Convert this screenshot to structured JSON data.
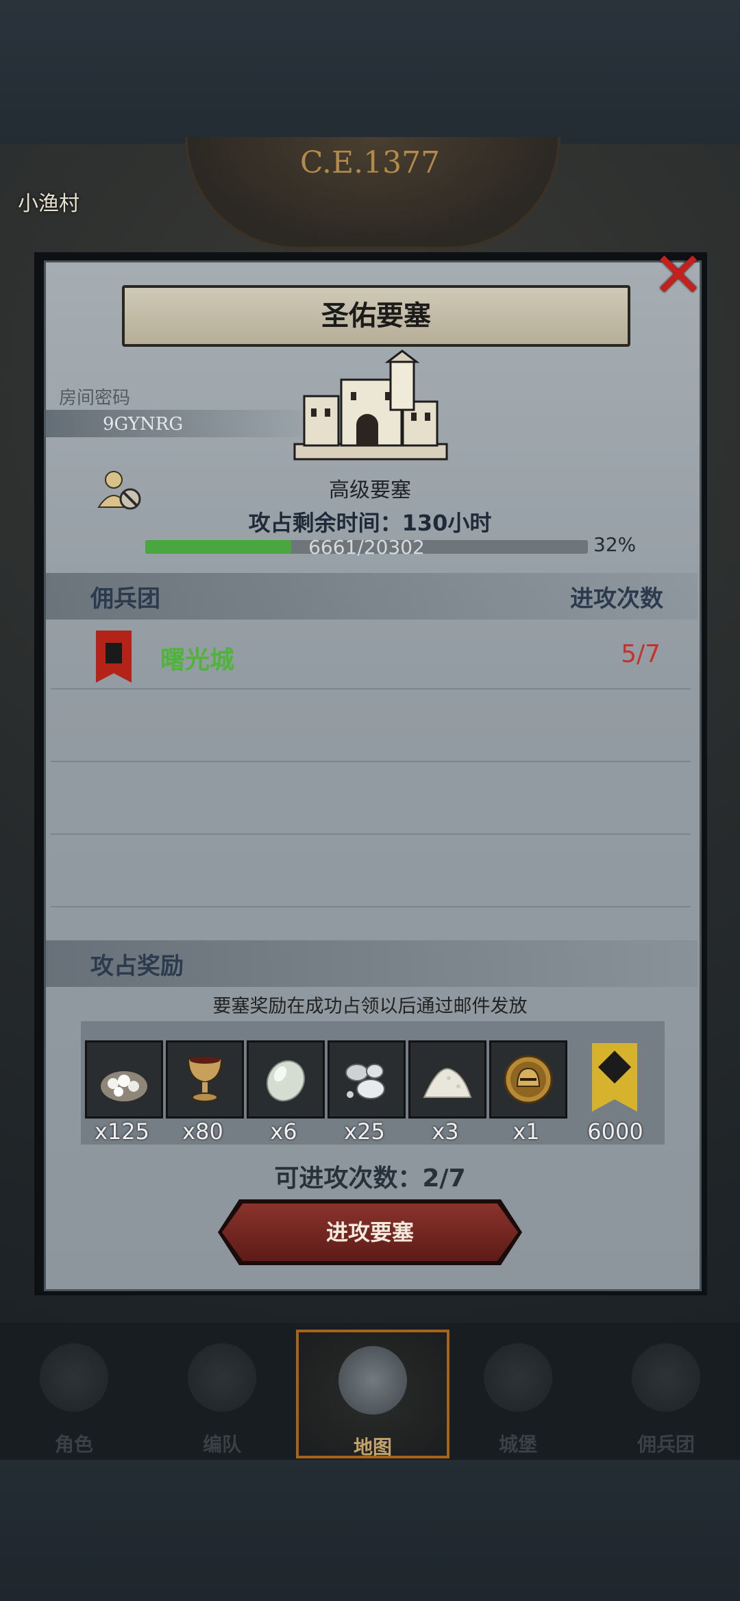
{
  "header": {
    "era": "C.E.1377",
    "village": "小渔村"
  },
  "modal": {
    "title": "圣佑要塞",
    "room_password_label": "房间密码",
    "room_password": "9GYNRG",
    "fortress_type": "高级要塞",
    "time_left": "攻占剩余时间：130小时",
    "progress": {
      "text": "6661/20302",
      "current": 6661,
      "total": 20302,
      "percent": "32%",
      "fraction": 0.33
    },
    "legion_header": "佣兵团",
    "attacks_header": "进攻次数",
    "legions": [
      {
        "name": "曙光城",
        "count": "5/7"
      }
    ],
    "rewards_header": "攻占奖励",
    "rewards_note": "要塞奖励在成功占领以后通过邮件发放",
    "rewards": [
      {
        "icon": "salt-sack-icon",
        "qty": "x125"
      },
      {
        "icon": "goblet-icon",
        "qty": "x80"
      },
      {
        "icon": "gem-stone-icon",
        "qty": "x6"
      },
      {
        "icon": "silver-ore-icon",
        "qty": "x25"
      },
      {
        "icon": "powder-pile-icon",
        "qty": "x3"
      },
      {
        "icon": "knight-helmet-coin-icon",
        "qty": "x1"
      },
      {
        "icon": "gold-banner-medal-icon",
        "qty": "6000"
      }
    ],
    "attempts": "可进攻次数：2/7",
    "attack_button": "进攻要塞"
  },
  "nav": [
    {
      "label": "角色",
      "icon": "knight-figure-icon"
    },
    {
      "label": "编队",
      "icon": "formation-icon"
    },
    {
      "label": "地图",
      "icon": "globe-map-icon"
    },
    {
      "label": "城堡",
      "icon": "castle-icon"
    },
    {
      "label": "佣兵团",
      "icon": "mercenary-icon"
    }
  ],
  "colors": {
    "accent_green": "#4fb43a",
    "attack_red": "#c6322a",
    "button": "#7a2a24",
    "gold": "#d7b22c"
  }
}
